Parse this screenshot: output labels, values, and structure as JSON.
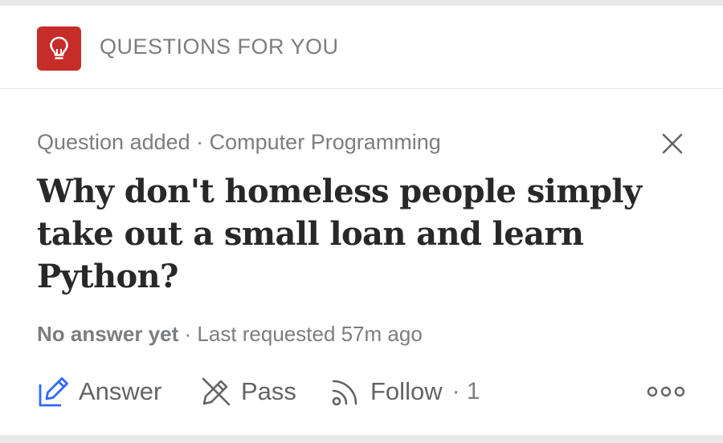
{
  "header": {
    "title": "QUESTIONS FOR YOU",
    "logo_icon": "lightbulb-icon",
    "brand_color": "#c62c28"
  },
  "question": {
    "meta": "Question added · Computer Programming",
    "text": "Why don't homeless people simply take out a small loan and learn Python?",
    "status_label": "No answer yet",
    "status_rest": " · Last requested 57m ago"
  },
  "actions": {
    "answer": "Answer",
    "pass": "Pass",
    "follow": "Follow",
    "follow_count": "· 1",
    "answer_icon": "pencil-icon",
    "pass_icon": "pencil-crossed-icon",
    "follow_icon": "rss-icon",
    "more_icon": "more-options-icon",
    "accent_color": "#2e69ff"
  }
}
